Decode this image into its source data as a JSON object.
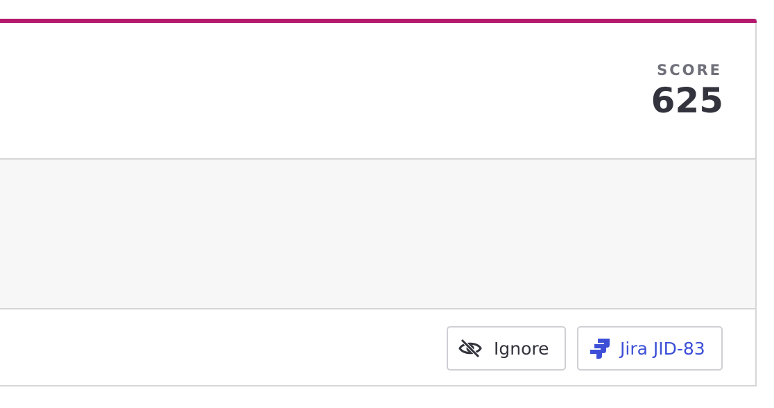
{
  "score": {
    "label": "SCORE",
    "value": "625"
  },
  "actions": {
    "ignore_label": "Ignore",
    "jira_label": "Jira JID-83"
  },
  "colors": {
    "accent": "#b5196e",
    "jira_blue": "#3d4fd6",
    "text_dark": "#33333d",
    "text_muted": "#6f6f7a"
  },
  "icons": {
    "ignore": "eye-slash-icon",
    "jira": "jira-icon"
  }
}
